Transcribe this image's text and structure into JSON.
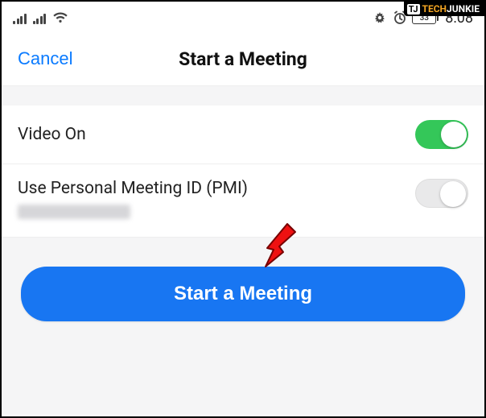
{
  "status": {
    "battery": "33",
    "time": "8:08"
  },
  "nav": {
    "cancel": "Cancel",
    "title": "Start a Meeting"
  },
  "options": {
    "video_on": {
      "label": "Video On",
      "state": true
    },
    "pmi": {
      "label": "Use Personal Meeting ID (PMI)",
      "state": false
    }
  },
  "primary_action": "Start a Meeting",
  "watermark": {
    "tj": "TJ",
    "tech": "TECH",
    "junkie": "JUNKIE"
  }
}
